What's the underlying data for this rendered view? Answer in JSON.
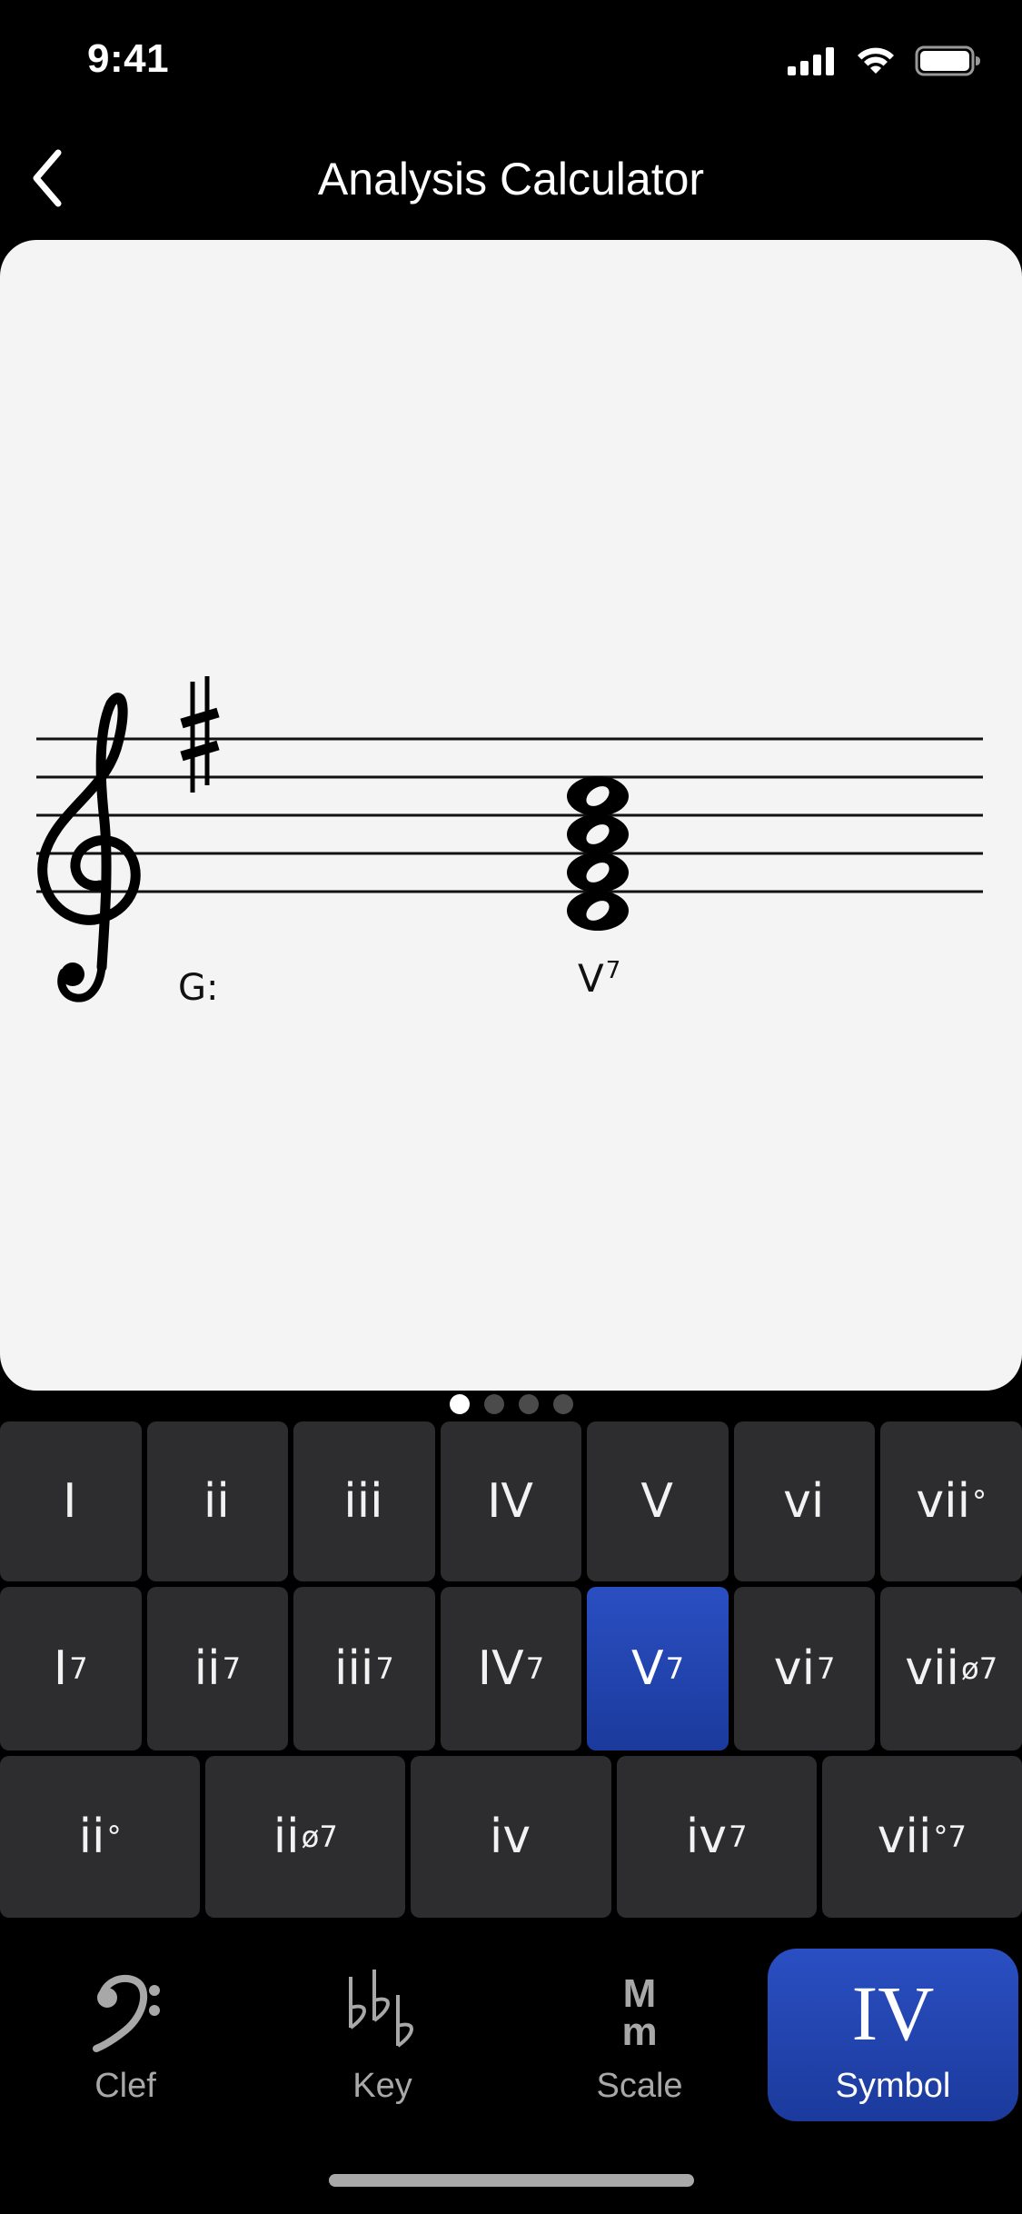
{
  "status_bar": {
    "time": "9:41"
  },
  "nav": {
    "title": "Analysis Calculator"
  },
  "staff": {
    "clef": "treble",
    "key_signature": "1 sharp",
    "key_label": "G:",
    "chord_label": "V",
    "chord_superscript": "7"
  },
  "page_dots": {
    "count": 4,
    "active": 1
  },
  "keyboard": {
    "row1": [
      {
        "label": "I",
        "sup": ""
      },
      {
        "label": "ii",
        "sup": ""
      },
      {
        "label": "iii",
        "sup": ""
      },
      {
        "label": "IV",
        "sup": ""
      },
      {
        "label": "V",
        "sup": ""
      },
      {
        "label": "vi",
        "sup": ""
      },
      {
        "label": "vii",
        "sup": "°"
      }
    ],
    "row2": [
      {
        "label": "I",
        "sup": "7"
      },
      {
        "label": "ii",
        "sup": "7"
      },
      {
        "label": "iii",
        "sup": "7"
      },
      {
        "label": "IV",
        "sup": "7"
      },
      {
        "label": "V",
        "sup": "7",
        "selected": true
      },
      {
        "label": "vi",
        "sup": "7"
      },
      {
        "label": "vii",
        "sup": "ø7"
      }
    ],
    "row3": [
      {
        "label": "ii",
        "sup": "°"
      },
      {
        "label": "ii",
        "sup": "ø7"
      },
      {
        "label": "iv",
        "sup": ""
      },
      {
        "label": "iv",
        "sup": "7"
      },
      {
        "label": "vii",
        "sup": "°7"
      }
    ]
  },
  "tabs": {
    "clef": {
      "label": "Clef",
      "icon": "bass-clef-icon"
    },
    "key": {
      "label": "Key",
      "icon": "flats-icon"
    },
    "scale": {
      "label": "Scale",
      "icon": "major-minor-icon",
      "icon_top": "M",
      "icon_bottom": "m"
    },
    "symbol": {
      "label": "Symbol",
      "icon": "roman-numeral-icon",
      "icon_text": "IV",
      "active": true
    }
  },
  "colors": {
    "background": "#000000",
    "card": "#f4f4f4",
    "key_cell": "#2d2d2f",
    "accent": "#2346b0"
  }
}
